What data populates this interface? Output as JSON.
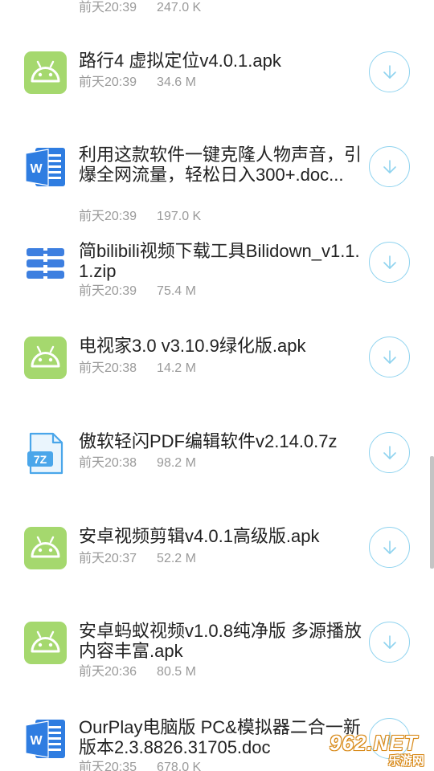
{
  "files": [
    {
      "icon": "android-icon",
      "name": "",
      "time": "前天20:39",
      "size": "247.0 K"
    },
    {
      "icon": "android-icon",
      "name": "路行4 虚拟定位v4.0.1.apk",
      "time": "前天20:39",
      "size": "34.6 M"
    },
    {
      "icon": "word-doc-icon",
      "name": "利用这款软件一键克隆人物声音，引爆全网流量，轻松日入300+.doc...",
      "time": "前天20:39",
      "size": "197.0 K"
    },
    {
      "icon": "zip-archive-icon",
      "name": "简bilibili视频下载工具Bilidown_v1.1.1.zip",
      "time": "前天20:39",
      "size": "75.4 M"
    },
    {
      "icon": "android-icon",
      "name": "电视家3.0 v3.10.9绿化版.apk",
      "time": "前天20:38",
      "size": "14.2 M"
    },
    {
      "icon": "7z-archive-icon",
      "name": "傲软轻闪PDF编辑软件v2.14.0.7z",
      "time": "前天20:38",
      "size": "98.2 M"
    },
    {
      "icon": "android-icon",
      "name": "安卓视频剪辑v4.0.1高级版.apk",
      "time": "前天20:37",
      "size": "52.2 M"
    },
    {
      "icon": "android-icon",
      "name": "安卓蚂蚁视频v1.0.8纯净版 多源播放内容丰富.apk",
      "time": "前天20:36",
      "size": "80.5 M"
    },
    {
      "icon": "word-doc-icon",
      "name": "OurPlay电脑版 PC&模拟器二合一新版本2.3.8826.31705.doc",
      "time": "前天20:35",
      "size": "678.0 K"
    }
  ],
  "icon_badges": {
    "7z": "7Z",
    "word": "W"
  },
  "watermark": {
    "main": "962.NET",
    "sub": "乐游网"
  },
  "colors": {
    "android_green": "#a5d86e",
    "word_blue": "#2f7de1",
    "zip_blue": "#3d7fe0",
    "archive_light_blue": "#4aa6ea",
    "download_ring": "#8fd3ef",
    "name_text": "#222222",
    "meta_text": "#9a9a9a"
  }
}
